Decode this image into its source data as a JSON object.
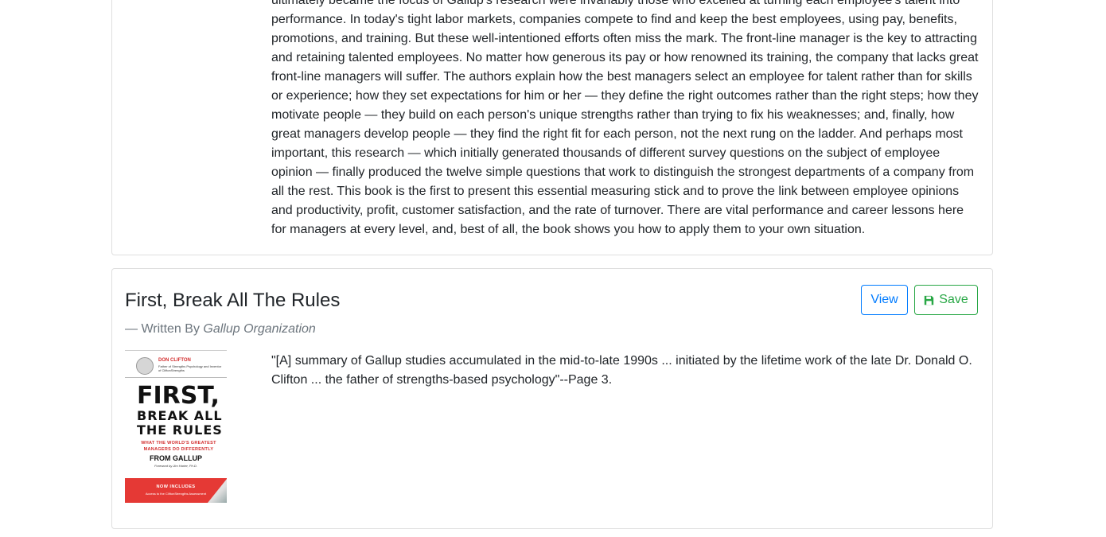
{
  "previous_book": {
    "description": "ultimately became the focus of Gallup's research were invariably those who excelled at turning each employee's talent into performance. In today's tight labor markets, companies compete to find and keep the best employees, using pay, benefits, promotions, and training. But these well-intentioned efforts often miss the mark. The front-line manager is the key to attracting and retaining talented employees. No matter how generous its pay or how renowned its training, the company that lacks great front-line managers will suffer. The authors explain how the best managers select an employee for talent rather than for skills or experience; how they set expectations for him or her — they define the right outcomes rather than the right steps; how they motivate people — they build on each person's unique strengths rather than trying to fix his weaknesses; and, finally, how great managers develop people — they find the right fit for each person, not the next rung on the ladder. And perhaps most important, this research — which initially generated thousands of different survey questions on the subject of employee opinion — finally produced the twelve simple questions that work to distinguish the strongest departments of a company from all the rest. This book is the first to present this essential measuring stick and to prove the link between employee opinions and productivity, profit, customer satisfaction, and the rate of turnover. There are vital performance and career lessons here for managers at every level, and, best of all, the book shows you how to apply them to your own situation."
  },
  "book": {
    "title": "First, Break All The Rules",
    "written_by_prefix": "— Written By ",
    "author": "Gallup Organization",
    "view_label": "View",
    "save_label": "Save",
    "save_icon": "floppy-disk-icon",
    "description": "\"[A] summary of Gallup studies accumulated in the mid-to-late 1990s ... initiated by the lifetime work of the late Dr. Donald O. Clifton ... the father of strengths-based psychology\"--Page 3.",
    "cover": {
      "author": "DON CLIFTON",
      "author_sub": "Father of Strengths Psychology and Inventor of CliftonStrengths",
      "title_line1": "FIRST,",
      "title_line2": "BREAK ALL",
      "title_line3": "THE RULES",
      "tagline": "WHAT THE WORLD'S GREATEST MANAGERS DO DIFFERENTLY",
      "from": "FROM GALLUP",
      "foreword": "Foreword by Jim Harter, Ph.D.",
      "now_includes": "NOW INCLUDES",
      "access": "Access to the CliftonStrengths Assessment"
    }
  },
  "colors": {
    "view_button": "#007bff",
    "save_button": "#28a745",
    "muted_text": "#6c757d",
    "cover_red": "#e53935"
  }
}
